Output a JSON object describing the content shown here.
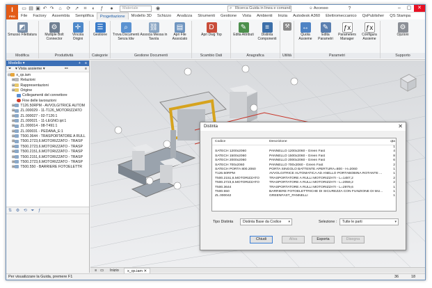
{
  "titlebar": {
    "app_logo": "I",
    "app_logo_sub": "PRO",
    "material_placeholder": "Materiale",
    "search_placeholder": "Ricerca Guida in linea e comandi",
    "login_label": "Accesso",
    "help_label": "?"
  },
  "ribbon_tabs": [
    "File",
    "Factory",
    "Assembla",
    "Semplifica",
    "Progettazione",
    "Modello 3D",
    "Schizzo",
    "Analizza",
    "Strumenti",
    "Gestione",
    "Vista",
    "Ambienti",
    "Inizia",
    "Autodesk A360",
    "Elettromeccanico",
    "QsPublisher",
    "QS Stampa"
  ],
  "ribbon_active_tab": "Progettazione",
  "ribbon_groups": [
    {
      "label": "Modifica",
      "buttons": [
        "Smusso Filettatura"
      ]
    },
    {
      "label": "Produttività",
      "buttons": [
        "Multiple Bolt Connector",
        "Vincola Origini"
      ]
    },
    {
      "label": "Categorie",
      "buttons": [
        "Gestione"
      ]
    },
    {
      "label": "Gestione Documenti",
      "buttons": [
        "Trova Documenti Senza Idw",
        "Associa Messa in Tavola",
        "Apri File Associato"
      ]
    },
    {
      "label": "Scambio Dati",
      "buttons": [
        "Apri Dwg Top"
      ]
    },
    {
      "label": "Anagrafica",
      "buttons": [
        "Edita Attributi",
        "Distinta Componenti"
      ]
    },
    {
      "label": "Utilità",
      "buttons": [
        ""
      ]
    },
    {
      "label": "Parametri",
      "buttons": [
        "Quota Assieme",
        "Edita Parametri",
        "Parameters Manager",
        "Configura Assieme"
      ]
    },
    {
      "label": "Supporto",
      "buttons": [
        "Opzioni"
      ]
    }
  ],
  "browser": {
    "title": "Modello",
    "view_label": "Vista assieme",
    "items": [
      "x_qs.iam",
      "Relazioni",
      "Rappresentazioni",
      "Origine",
      "Collegamenti del connettore",
      "Fine delle lavorazioni",
      "T126.50RPM - AVVOLGITRICE AUTOM",
      "ZL.000029 - 11-T126_MOTORIZZATO",
      "ZL.000027 - 02-T126:1",
      "ZL.000021 - 11-LEGNO.ipt:1",
      "ZL.000014 - 08-T491:1",
      "ZL.000031 - PEDANA_E:1",
      "T500.3644 - TRASPORTATORE A RULL",
      "T500.2723,6.MOTORIZZATO - TRASP",
      "T500.2723,6.MOTORIZZATO - TRASP",
      "T500.2151,6.MOTORIZZATO - TRASP",
      "T500.2151,6.MOTORIZZATO - TRASP",
      "T500.2723,6.MOTORIZZATO - TRASP",
      "T500.550 - BARRIERE FOTOELETTR"
    ]
  },
  "doc_tabs": [
    "Inizio",
    "x_qs.iam"
  ],
  "status_bar": {
    "message": "Per visualizzare la Guida, premere F1",
    "count_a": "36",
    "count_b": "18"
  },
  "dialog": {
    "title": "Distinta",
    "columns": [
      "Codice",
      "Descrizione",
      "qta"
    ],
    "rows": [
      {
        "codice": "",
        "descrizione": "",
        "qta": "1"
      },
      {
        "codice": "SATECH 1200x2060",
        "descrizione": "PANNELLO 1200x2060 - Green Fast",
        "qta": "4"
      },
      {
        "codice": "SATECH 1500x2060",
        "descrizione": "PANNELLO 1500x2060 - Green Fast",
        "qta": "8"
      },
      {
        "codice": "SATECH 2000x2060",
        "descrizione": "PANNELLO 2000x2060 - Green Fast",
        "qta": "6"
      },
      {
        "codice": "SATECH 700x2060",
        "descrizione": "PANNELLO 700x2060 - Green Fast",
        "qta": "2"
      },
      {
        "codice": "SATECH PORTA 800.2060",
        "descrizione": "PORTA SINGOLO BATTENTE APERTURA=800 - H=2060",
        "qta": "1"
      },
      {
        "codice": "T126.50RPM",
        "descrizione": "AVVOLGITRICE AUTOMATICA AD ANELLO PORTABOBINA ROTANTE ...",
        "qta": "1"
      },
      {
        "codice": "T500.2151,6.MOTORIZZATO",
        "descrizione": "TRASPORTATORE A RULLI MOTORIZZATI - L=1487,2",
        "qta": "2"
      },
      {
        "codice": "T500.2723,6.MOTORIZZATO",
        "descrizione": "TRASPORTATORE A RULLI MOTORIZZATI - L=2059,2",
        "qta": "2"
      },
      {
        "codice": "T500.3644",
        "descrizione": "TRASPORTATORE A RULLI MOTORIZZATI - L=2979,6",
        "qta": "1"
      },
      {
        "codice": "T500.550",
        "descrizione": "BARRIERE FOTOELETTRICHE DI SICUREZZA CON FUNZIONE DI MU...",
        "qta": "1"
      },
      {
        "codice": "ZL.000042",
        "descrizione": "GREENFAST_PANNELLI",
        "qta": "1"
      }
    ],
    "tipo_label": "Tipo Distinta",
    "tipo_value": "Distinta Base da Codice",
    "selezione_label": "Selezione :",
    "selezione_value": "Tutte le parti",
    "buttons": {
      "chiudi": "Chiudi",
      "aliva": "Aliva",
      "esporta": "Esporta",
      "disegna": "Disegna"
    }
  },
  "colors": {
    "accent": "#3b6fb6",
    "app_logo": "#e35b16",
    "close_button": "#e81123"
  }
}
